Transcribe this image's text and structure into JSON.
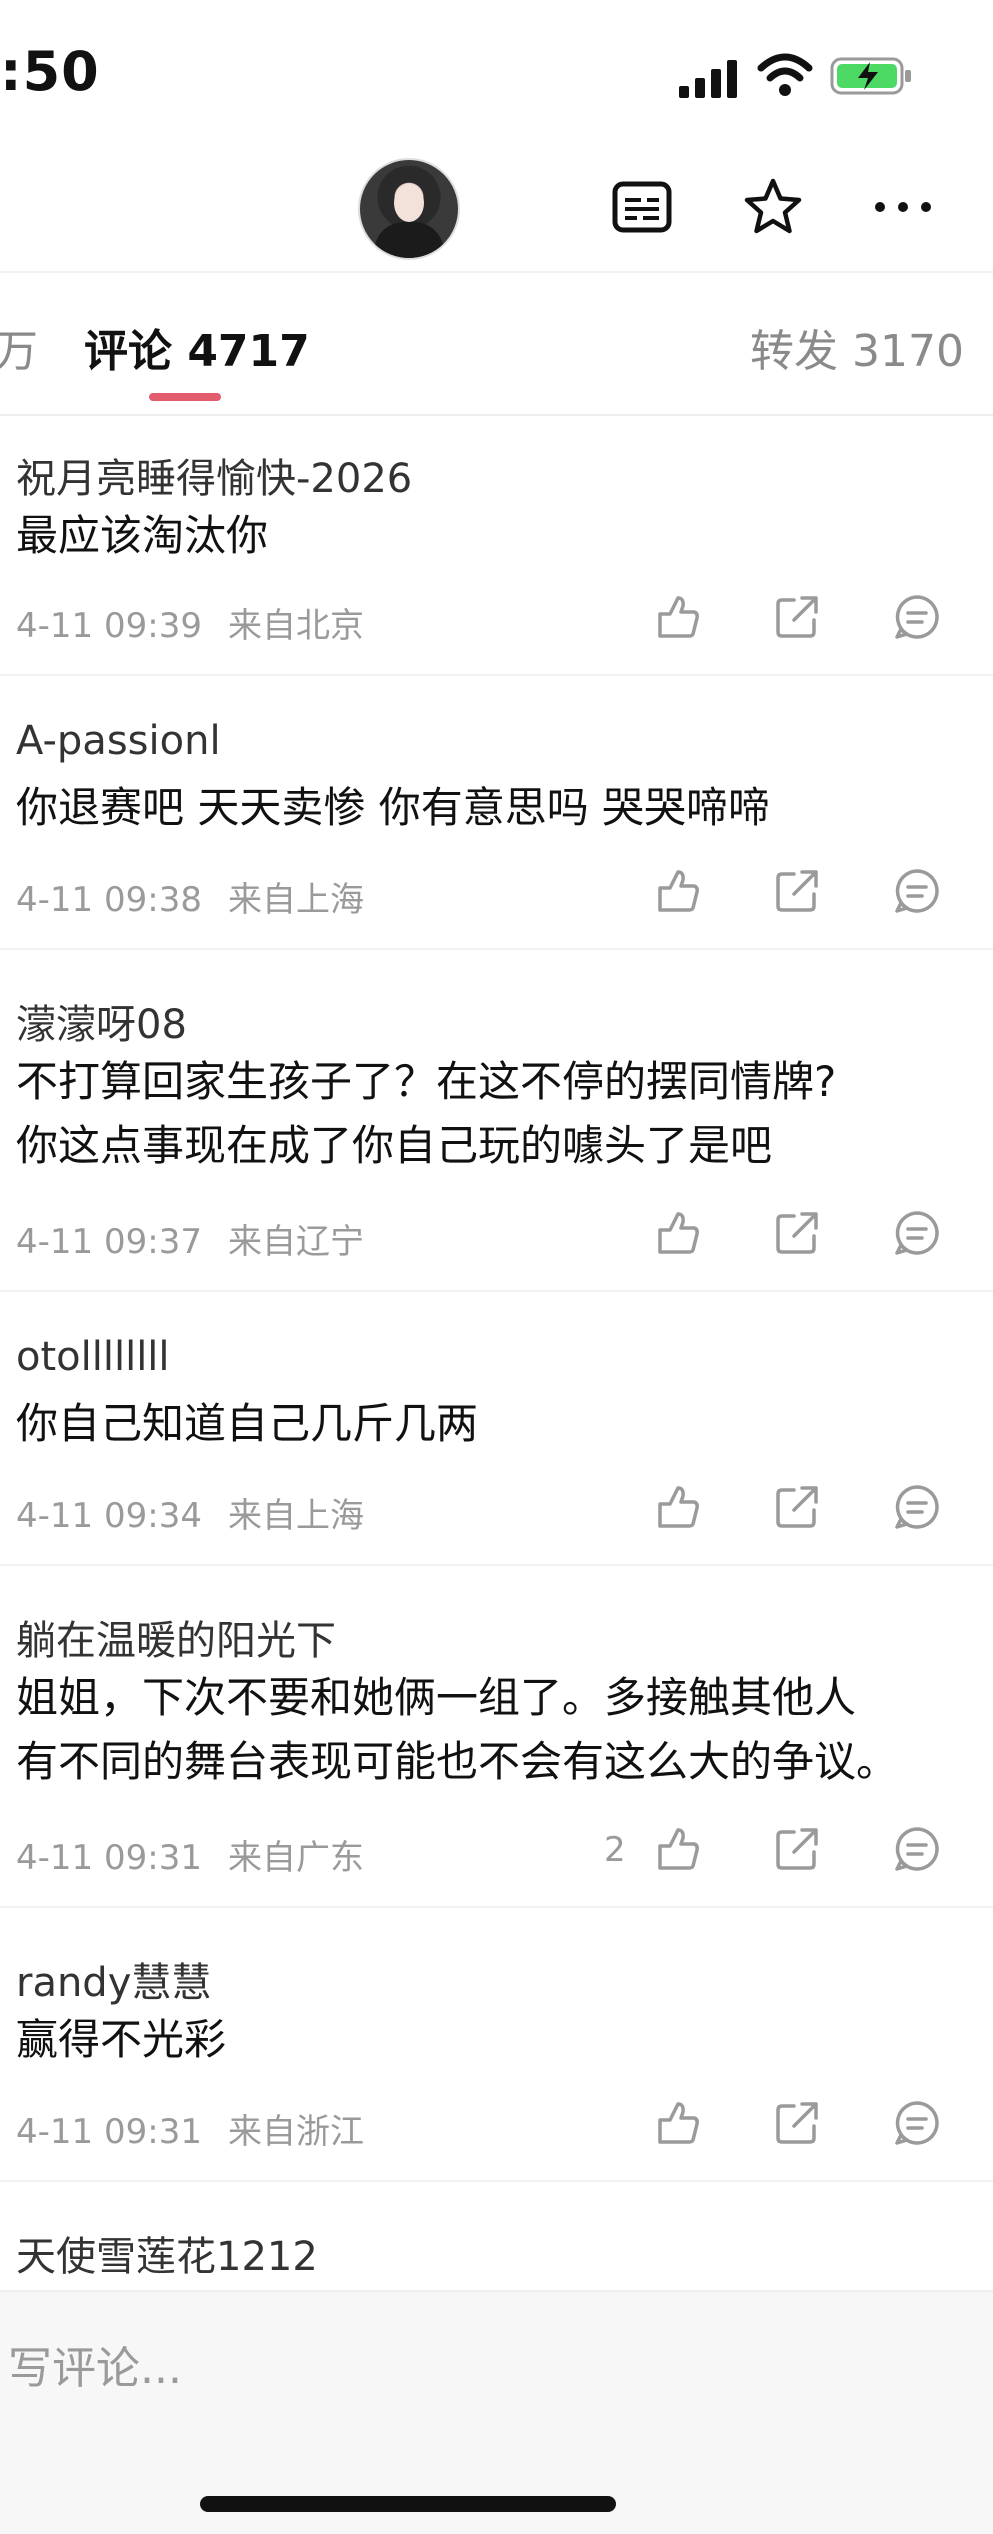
{
  "status": {
    "time": ":50"
  },
  "tabs": {
    "left_partial": "万",
    "comments": "评论 4717",
    "reposts": "转发 3170"
  },
  "comments": [
    {
      "user": "祝月亮睡得愉快-2026",
      "text_lines": [
        "最应该淘汰你"
      ],
      "date": "4-11 09:39",
      "location": "来自北京",
      "likes": ""
    },
    {
      "user": "A-passionl",
      "text_lines": [
        "你退赛吧  天天卖惨 你有意思吗 哭哭啼啼"
      ],
      "date": "4-11 09:38",
      "location": "来自上海",
      "likes": ""
    },
    {
      "user": "濛濛呀08",
      "text_lines": [
        "不打算回家生孩子了？在这不停的摆同情牌?",
        "你这点事现在成了你自己玩的噱头了是吧"
      ],
      "date": "4-11 09:37",
      "location": "来自辽宁",
      "likes": ""
    },
    {
      "user": "otollllllll",
      "text_lines": [
        "你自己知道自己几斤几两"
      ],
      "date": "4-11 09:34",
      "location": "来自上海",
      "likes": ""
    },
    {
      "user": "躺在温暖的阳光下",
      "text_lines": [
        "姐姐，下次不要和她俩一组了。多接触其他人",
        "有不同的舞台表现可能也不会有这么大的争议。"
      ],
      "date": "4-11 09:31",
      "location": "来自广东",
      "likes": "2"
    },
    {
      "user": "randy慧慧",
      "text_lines": [
        "赢得不光彩"
      ],
      "date": "4-11 09:31",
      "location": "来自浙江",
      "likes": ""
    },
    {
      "user": "天使雪莲花1212",
      "text_lines": [],
      "date": "",
      "location": "",
      "likes": ""
    }
  ],
  "input": {
    "placeholder": "写评论..."
  },
  "colors": {
    "accent": "#e35c6d",
    "battery": "#4cd964",
    "muted": "#9a9a9a"
  },
  "icons": [
    "signal-icon",
    "wifi-icon",
    "battery-icon",
    "subtitle-icon",
    "star-icon",
    "more-icon",
    "like-icon",
    "share-icon",
    "reply-icon"
  ]
}
